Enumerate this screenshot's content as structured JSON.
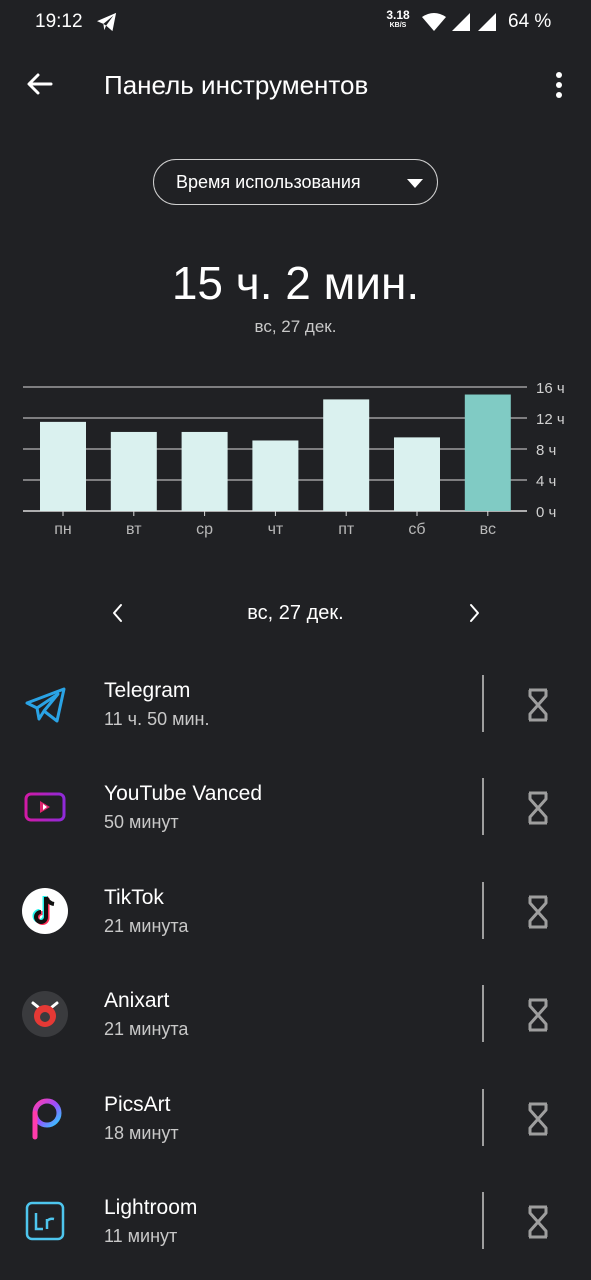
{
  "status_bar": {
    "time": "19:12",
    "net_speed_value": "3.18",
    "net_speed_unit": "KB/S",
    "battery": "64 %"
  },
  "app_bar": {
    "title": "Панель инструментов",
    "back_icon": "arrow-left-icon",
    "menu_icon": "more-vert-icon"
  },
  "metric_selector": {
    "selected": "Время использования"
  },
  "summary": {
    "total": "15 ч. 2 мин.",
    "date": "вс, 27 дек."
  },
  "chart_data": {
    "type": "bar",
    "categories": [
      "пн",
      "вт",
      "ср",
      "чт",
      "пт",
      "сб",
      "вс"
    ],
    "values": [
      11.5,
      10.2,
      10.2,
      9.1,
      14.4,
      9.5,
      15.03
    ],
    "selected_index": 6,
    "y_ticks": [
      "16 ч",
      "12 ч",
      "8 ч",
      "4 ч",
      "0 ч"
    ],
    "ylim": [
      0,
      16
    ],
    "grid": true,
    "colors": {
      "bar": "#daf1ef",
      "selected": "#80cbc4",
      "grid": "#dcdcdc"
    }
  },
  "day_nav": {
    "date": "вс, 27 дек."
  },
  "apps": [
    {
      "name": "Telegram",
      "time": "11 ч. 50 мин.",
      "icon": "telegram-icon"
    },
    {
      "name": "YouTube Vanced",
      "time": "50 минут",
      "icon": "youtube-vanced-icon"
    },
    {
      "name": "TikTok",
      "time": "21 минута",
      "icon": "tiktok-icon"
    },
    {
      "name": "Anixart",
      "time": "21 минута",
      "icon": "anixart-icon"
    },
    {
      "name": "PicsArt",
      "time": "18 минут",
      "icon": "picsart-icon"
    },
    {
      "name": "Lightroom",
      "time": "11 минут",
      "icon": "lightroom-icon"
    }
  ]
}
